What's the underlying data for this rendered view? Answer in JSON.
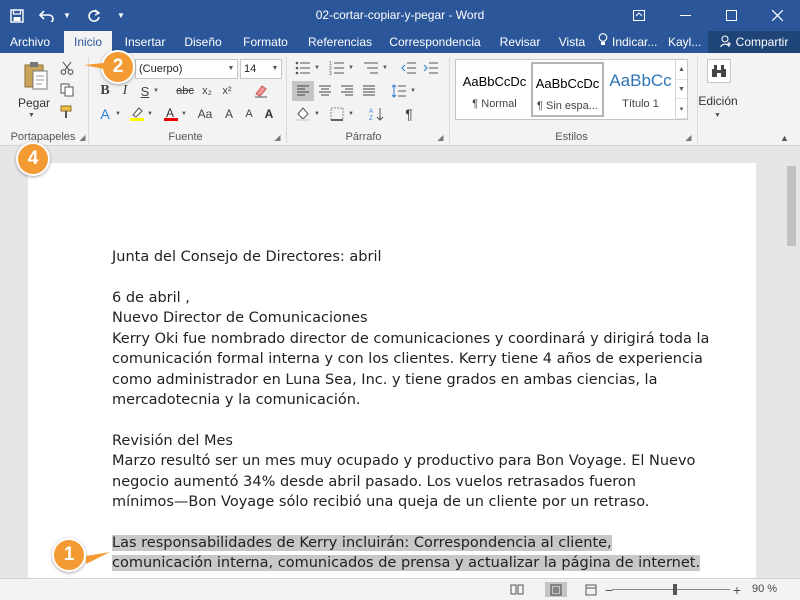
{
  "window": {
    "title": "02-cortar-copiar-y-pegar  -  Word"
  },
  "tabs": [
    {
      "label": "Archivo"
    },
    {
      "label": "Inicio"
    },
    {
      "label": "Insertar"
    },
    {
      "label": "Diseño"
    },
    {
      "label": "Formato"
    },
    {
      "label": "Referencias"
    },
    {
      "label": "Correspondencia"
    },
    {
      "label": "Revisar"
    },
    {
      "label": "Vista"
    }
  ],
  "tell_me": "Indicar...",
  "user": "Kayl...",
  "share": "Compartir",
  "ribbon": {
    "clipboard": {
      "paste_label": "Pegar",
      "group_label": "Portapapeles"
    },
    "font": {
      "font_name": "(Cuerpo)",
      "font_size": "14",
      "group_label": "Fuente"
    },
    "paragraph": {
      "group_label": "Párrafo"
    },
    "styles": {
      "group_label": "Estilos",
      "items": [
        {
          "sample": "AaBbCcDc",
          "name": "¶ Normal"
        },
        {
          "sample": "AaBbCcDc",
          "name": "¶ Sin espa..."
        },
        {
          "sample": "AaBbCc",
          "name": "Título 1"
        }
      ]
    },
    "editing": {
      "label": "Edición"
    }
  },
  "document": {
    "title_line": "Junta del Consejo de Directores:   abril",
    "date_line": "6 de    abril ,",
    "section1_heading": "Nuevo Director de Comunicaciones",
    "section1_lines": [
      "Kerry Oki fue nombrado director de comunicaciones y coordinará y dirigirá toda la",
      "comunicación formal interna y con los clientes. Kerry tiene 4 años de experiencia",
      "como administrador en Luna Sea, Inc. y tiene grados en ambas ciencias, la",
      "mercadotecnia y la comunicación."
    ],
    "section2_heading": "Revisión del Mes",
    "section2_lines": [
      "Marzo resultó ser un mes muy ocupado y productivo para Bon Voyage. El Nuevo",
      "negocio aumentó 34% desde abril pasado. Los vuelos retrasados fueron",
      "mínimos—Bon Voyage sólo recibió una queja de un cliente por un retraso."
    ],
    "selected_lines": [
      "Las responsabilidades de Kerry incluirán: Correspondencia al cliente,",
      "comunicación interna, comunicados de prensa y actualizar la página de internet."
    ]
  },
  "status": {
    "zoom": "90 %"
  },
  "callouts": [
    "1",
    "2",
    "4"
  ],
  "colors": {
    "brand": "#2b579a",
    "callout": "#f39a33",
    "highlight": "#c8c8c8"
  }
}
